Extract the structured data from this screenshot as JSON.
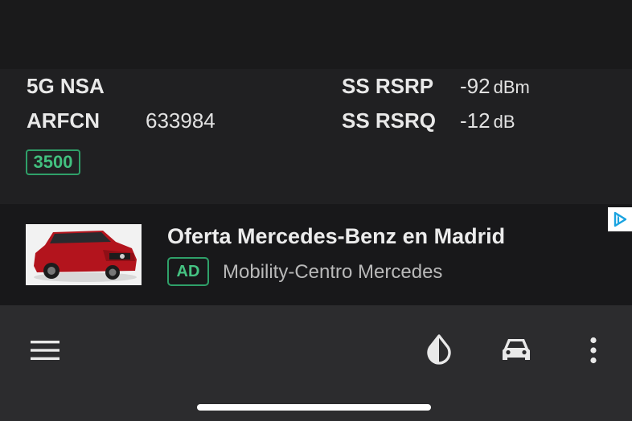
{
  "network": {
    "tech_label": "5G NSA",
    "arfcn_label": "ARFCN",
    "arfcn_value": "633984",
    "band": "3500"
  },
  "signal": {
    "rsrp_label": "SS RSRP",
    "rsrp_value": "-92",
    "rsrp_unit": "dBm",
    "rsrq_label": "SS RSRQ",
    "rsrq_value": "-12",
    "rsrq_unit": "dB"
  },
  "ad": {
    "title": "Oferta Mercedes-Benz en Madrid",
    "badge": "AD",
    "advertiser": "Mobility-Centro Mercedes",
    "image_icon": "red-suv-image",
    "choices_icon": "adchoices-icon"
  },
  "navbar": {
    "menu_icon": "hamburger-menu-icon",
    "theme_icon": "contrast-drop-icon",
    "car_icon": "car-icon",
    "more_icon": "more-vertical-icon"
  },
  "colors": {
    "accent_green": "#2fa069",
    "background": "#1f1f21",
    "navbar": "#2c2c2e"
  }
}
